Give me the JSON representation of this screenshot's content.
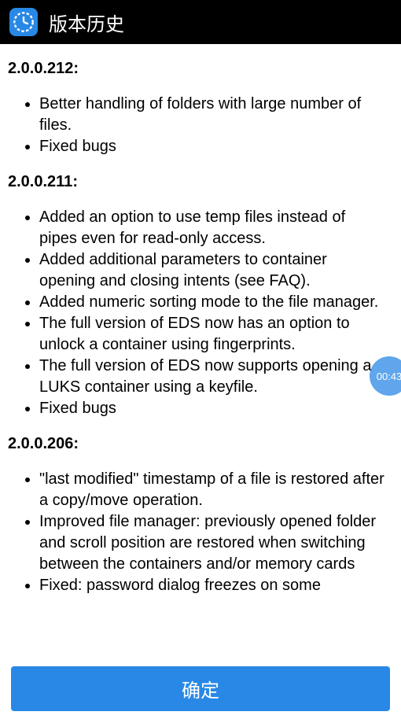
{
  "header": {
    "title": "版本历史"
  },
  "floating_timer": "00:43",
  "footer": {
    "confirm_label": "确定"
  },
  "versions": [
    {
      "number": "2.0.0.212",
      "changes": [
        "Better handling of folders with large number of files.",
        "Fixed bugs"
      ]
    },
    {
      "number": "2.0.0.211",
      "changes": [
        "Added an option to use temp files instead of pipes even for read-only access.",
        "Added additional parameters to container opening and closing intents (see FAQ).",
        "Added numeric sorting mode to the file manager.",
        "The full version of EDS now has an option to unlock a container using fingerprints.",
        "The full version of EDS now supports opening a LUKS container using a keyfile.",
        "Fixed bugs"
      ]
    },
    {
      "number": "2.0.0.206",
      "changes": [
        "\"last modified\" timestamp of a file is restored after a copy/move operation.",
        "Improved file manager: previously opened folder and scroll position are restored when switching between the containers and/or memory cards",
        "Fixed: password dialog freezes on some"
      ]
    }
  ]
}
